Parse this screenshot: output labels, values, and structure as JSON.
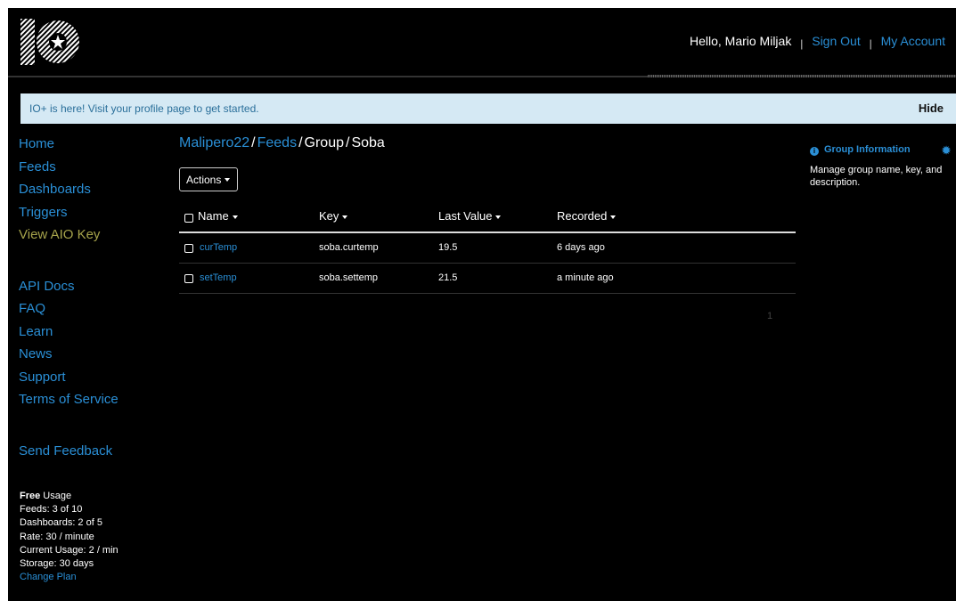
{
  "header": {
    "greeting": "Hello, Mario Miljak",
    "sign_out": "Sign Out",
    "my_account": "My Account",
    "separator": "|"
  },
  "banner": {
    "text_prefix": "IO+ is here! Visit your ",
    "profile_link": "profile page",
    "text_suffix": " to get started.",
    "hide": "Hide"
  },
  "nav": {
    "primary": [
      "Home",
      "Feeds",
      "Dashboards",
      "Triggers"
    ],
    "aio_key": "View AIO Key",
    "secondary": [
      "API Docs",
      "FAQ",
      "Learn",
      "News",
      "Support",
      "Terms of Service"
    ],
    "feedback": "Send Feedback"
  },
  "usage": {
    "plan": "Free",
    "plan_suffix": " Usage",
    "lines": [
      "Feeds: 3 of 10",
      "Dashboards: 2 of 5",
      "Rate: 30 / minute",
      "Current Usage: 2 / min",
      "Storage: 30 days"
    ],
    "change_plan": "Change Plan"
  },
  "breadcrumb": {
    "user": "Malipero22",
    "feeds": "Feeds",
    "group": "Group",
    "current": "Soba",
    "sep": "/"
  },
  "actions": {
    "label": "Actions"
  },
  "table": {
    "headers": [
      "Name",
      "Key",
      "Last Value",
      "Recorded"
    ],
    "rows": [
      {
        "name": "curTemp",
        "key": "soba.curtemp",
        "value": "19.5",
        "recorded": "6 days ago"
      },
      {
        "name": "setTemp",
        "key": "soba.settemp",
        "value": "21.5",
        "recorded": "a minute ago"
      }
    ]
  },
  "pager": {
    "page": "1"
  },
  "info": {
    "title": "Group Information",
    "description": "Manage group name, key, and description."
  },
  "colors": {
    "link": "#2a8fd6",
    "aio_key": "#a6a34b",
    "banner_bg": "#d5e9f4",
    "background": "#000000"
  }
}
